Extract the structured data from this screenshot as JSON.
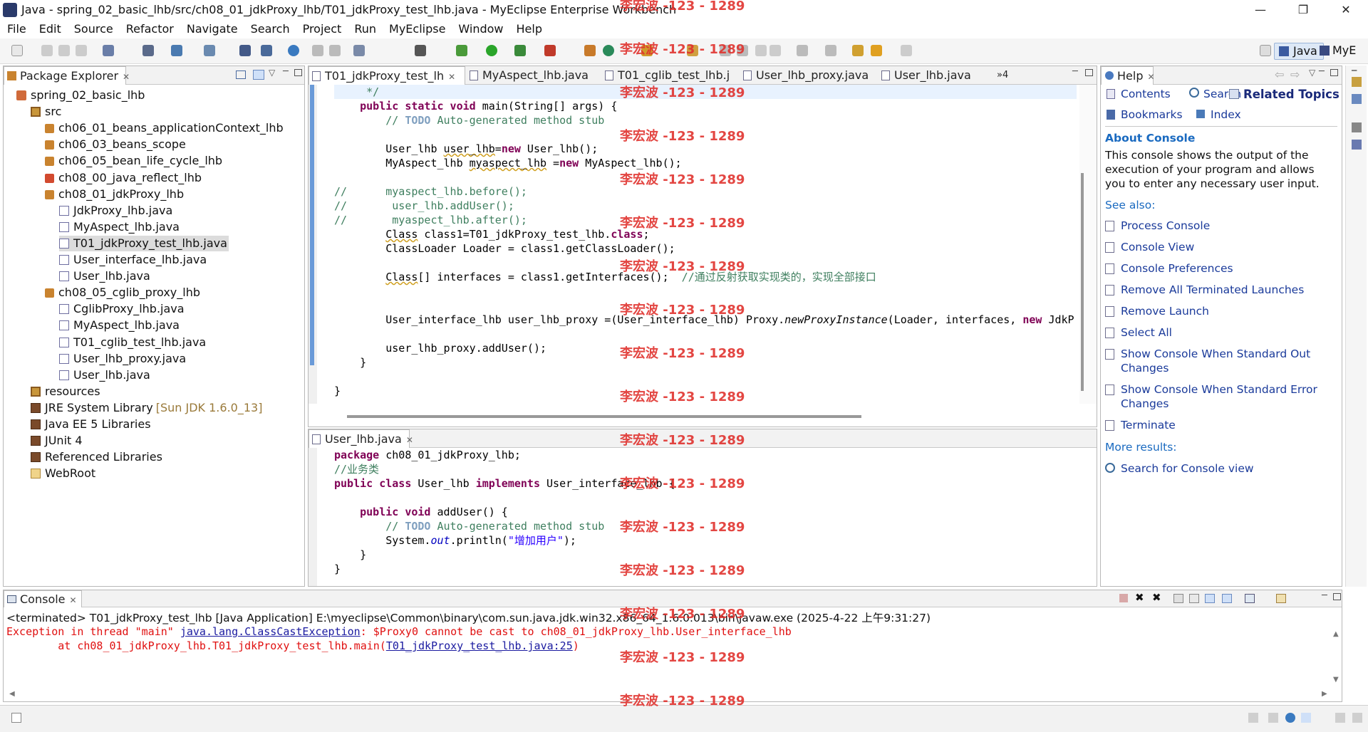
{
  "window": {
    "title": "Java - spring_02_basic_lhb/src/ch08_01_jdkProxy_lhb/T01_jdkProxy_test_lhb.java - MyEclipse Enterprise Workbench"
  },
  "menu": [
    "File",
    "Edit",
    "Source",
    "Refactor",
    "Navigate",
    "Search",
    "Project",
    "Run",
    "MyEclipse",
    "Window",
    "Help"
  ],
  "perspectives": [
    "Java",
    "MyE"
  ],
  "package_explorer": {
    "title": "Package Explorer",
    "items": [
      {
        "label": "spring_02_basic_lhb",
        "type": "proj"
      },
      {
        "label": "src",
        "type": "src"
      },
      {
        "label": "ch06_01_beans_applicationContext_lhb",
        "type": "pkg"
      },
      {
        "label": "ch06_03_beans_scope",
        "type": "pkg"
      },
      {
        "label": "ch06_05_bean_life_cycle_lhb",
        "type": "pkg"
      },
      {
        "label": "ch08_00_java_reflect_lhb",
        "type": "pkg"
      },
      {
        "label": "ch08_01_jdkProxy_lhb",
        "type": "pkg"
      },
      {
        "label": "JdkProxy_lhb.java",
        "type": "java"
      },
      {
        "label": "MyAspect_lhb.java",
        "type": "java"
      },
      {
        "label": "T01_jdkProxy_test_lhb.java",
        "type": "java"
      },
      {
        "label": "User_interface_lhb.java",
        "type": "java"
      },
      {
        "label": "User_lhb.java",
        "type": "java"
      },
      {
        "label": "ch08_05_cglib_proxy_lhb",
        "type": "pkg"
      },
      {
        "label": "CglibProxy_lhb.java",
        "type": "java"
      },
      {
        "label": "MyAspect_lhb.java",
        "type": "java"
      },
      {
        "label": "T01_cglib_test_lhb.java",
        "type": "java"
      },
      {
        "label": "User_lhb_proxy.java",
        "type": "java"
      },
      {
        "label": "User_lhb.java",
        "type": "java"
      },
      {
        "label": "resources",
        "type": "src"
      },
      {
        "label": "JRE System Library",
        "suffix": "[Sun JDK 1.6.0_13]",
        "type": "lib"
      },
      {
        "label": "Java EE 5 Libraries",
        "type": "lib"
      },
      {
        "label": "JUnit 4",
        "type": "lib"
      },
      {
        "label": "Referenced Libraries",
        "type": "lib"
      },
      {
        "label": "WebRoot",
        "type": "fold"
      }
    ]
  },
  "editor_tabs": [
    {
      "label": "T01_jdkProxy_test_lh"
    },
    {
      "label": "MyAspect_lhb.java"
    },
    {
      "label": "T01_cglib_test_lhb.j"
    },
    {
      "label": "User_lhb_proxy.java"
    },
    {
      "label": "User_lhb.java"
    },
    {
      "label": "»4"
    }
  ],
  "editor_main": {
    "line0": "     */",
    "line1_kw": "public static void",
    "line1_rest": " main(String[] args) {",
    "line2_todo": "TODO",
    "line2_rest": " Auto-generated method stub",
    "line3_a": "User_lhb ",
    "line3_b": "user_lhb",
    "line3_c": "=",
    "line3_kw": "new",
    "line3_d": " User_lhb();",
    "line4_a": "MyAspect_lhb ",
    "line4_b": "myaspect_lhb",
    "line4_c": " =",
    "line4_kw": "new",
    "line4_d": " MyAspect_lhb();",
    "line5": "//      myaspect_lhb.before();",
    "line6": "//       user_lhb.addUser();",
    "line7": "//       myaspect_lhb.after();",
    "line8_a": "Class",
    "line8_b": " class1=T01_jdkProxy_test_lhb.",
    "line8_kw": "class",
    "line8_c": ";",
    "line9": "ClassLoader Loader = class1.getClassLoader();",
    "line10_a": "Class",
    "line10_b": "[] interfaces = class1.getInterfaces();  ",
    "line10_cm": "//通过反射获取实现类的，实现全部接口",
    "line11_a": "User_interface_lhb user_lhb_proxy =(User_interface_lhb) Proxy.",
    "line11_it": "newProxyInstance",
    "line11_b": "(Loader, interfaces, ",
    "line11_kw": "new",
    "line11_c": " JdkP",
    "line12": "user_lhb_proxy.addUser();",
    "line13": "}",
    "line14": "}"
  },
  "editor_second": {
    "tab": "User_lhb.java",
    "l1_kw": "package",
    "l1_rest": " ch08_01_jdkProxy_lhb;",
    "l2": "//业务类",
    "l3_kw1": "public class",
    "l3_a": " User_lhb ",
    "l3_kw2": "implements",
    "l3_b": " User_interface_lhb {",
    "l4_kw": "public void",
    "l4_rest": " addUser() {",
    "l5_todo": "TODO",
    "l5_rest": " Auto-generated method stub",
    "l6_a": "System.",
    "l6_it": "out",
    "l6_b": ".println(",
    "l6_str": "\"增加用户\"",
    "l6_c": ");",
    "l7": "}",
    "l8": "}"
  },
  "help": {
    "title": "Help",
    "contents": "Contents",
    "search": "Search",
    "related": "Related Topics",
    "bookmarks": "Bookmarks",
    "index": "Index",
    "about_title": "About Console",
    "about_text": "This console shows the output of the execution of your program and allows you to enter any necessary user input.",
    "see_also": "See also:",
    "links": [
      "Process Console",
      "Console View",
      "Console Preferences",
      "Remove All Terminated Launches",
      "Remove Launch",
      "Select All",
      "Show Console When Standard Out Changes",
      "Show Console When Standard Error Changes",
      "Terminate"
    ],
    "more_results": "More results:",
    "search_link": "Search for Console view"
  },
  "console": {
    "title": "Console",
    "status": "<terminated> T01_jdkProxy_test_lhb [Java Application] E:\\myeclipse\\Common\\binary\\com.sun.java.jdk.win32.x86_64_1.6.0.013\\bin\\javaw.exe (2025-4-22 上午9:31:27)",
    "err1_a": "Exception in thread \"main\" ",
    "err1_link": "java.lang.ClassCastException",
    "err1_b": ": $Proxy0 cannot be cast to ch08_01_jdkProxy_lhb.User_interface_lhb",
    "err2_a": "        at ch08_01_jdkProxy_lhb.T01_jdkProxy_test_lhb.main(",
    "err2_link": "T01_jdkProxy_test_lhb.java:25",
    "err2_b": ")"
  },
  "watermark": "李宏波 -123 - 1289",
  "colors": {
    "keyword": "#7f0055",
    "comment": "#3f7f5f",
    "string": "#2a00ff",
    "error": "#e01010",
    "link": "#1a3a9a",
    "watermark": "#e0322e"
  }
}
